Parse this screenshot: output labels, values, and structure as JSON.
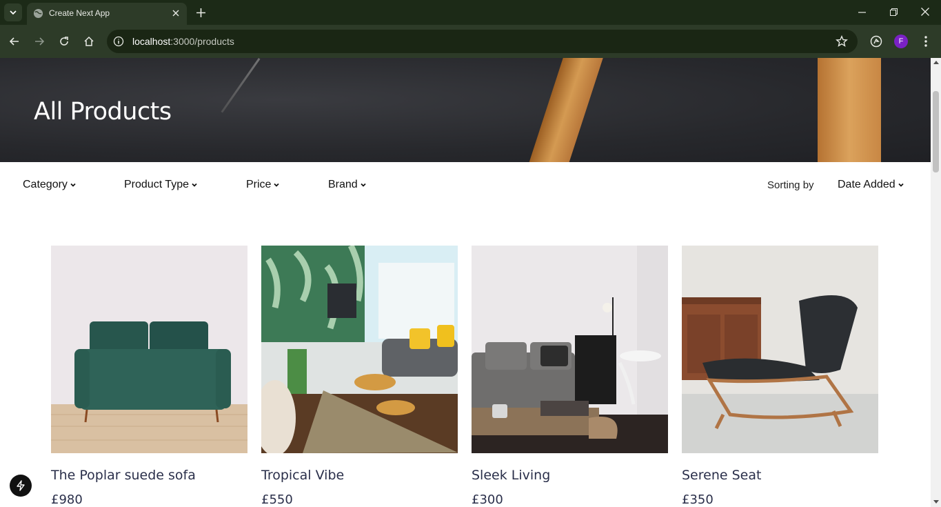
{
  "browser": {
    "tab_title": "Create Next App",
    "url_host": "localhost",
    "url_rest": ":3000/products",
    "profile_initial": "F",
    "icons": [
      "tab-search-icon",
      "globe-icon",
      "close-icon",
      "plus-icon",
      "minimize-icon",
      "restore-icon",
      "window-close-icon",
      "back-icon",
      "forward-icon",
      "reload-icon",
      "home-icon",
      "info-icon",
      "star-icon",
      "extension-icon",
      "menu-icon"
    ]
  },
  "hero": {
    "title": "All Products"
  },
  "filters": {
    "category": "Category",
    "product_type": "Product Type",
    "price": "Price",
    "brand": "Brand",
    "sort_label": "Sorting by",
    "sort_value": "Date Added"
  },
  "products": [
    {
      "name": "The Poplar suede sofa",
      "price": "£980"
    },
    {
      "name": "Tropical Vibe",
      "price": "£550"
    },
    {
      "name": "Sleek Living",
      "price": "£300"
    },
    {
      "name": "Serene Seat",
      "price": "£350"
    }
  ],
  "colors": {
    "chrome_dark": "#1c2a17",
    "chrome_toolbar": "#2d3b28",
    "text_product": "#2a2f4a",
    "avatar": "#7a21c4"
  }
}
